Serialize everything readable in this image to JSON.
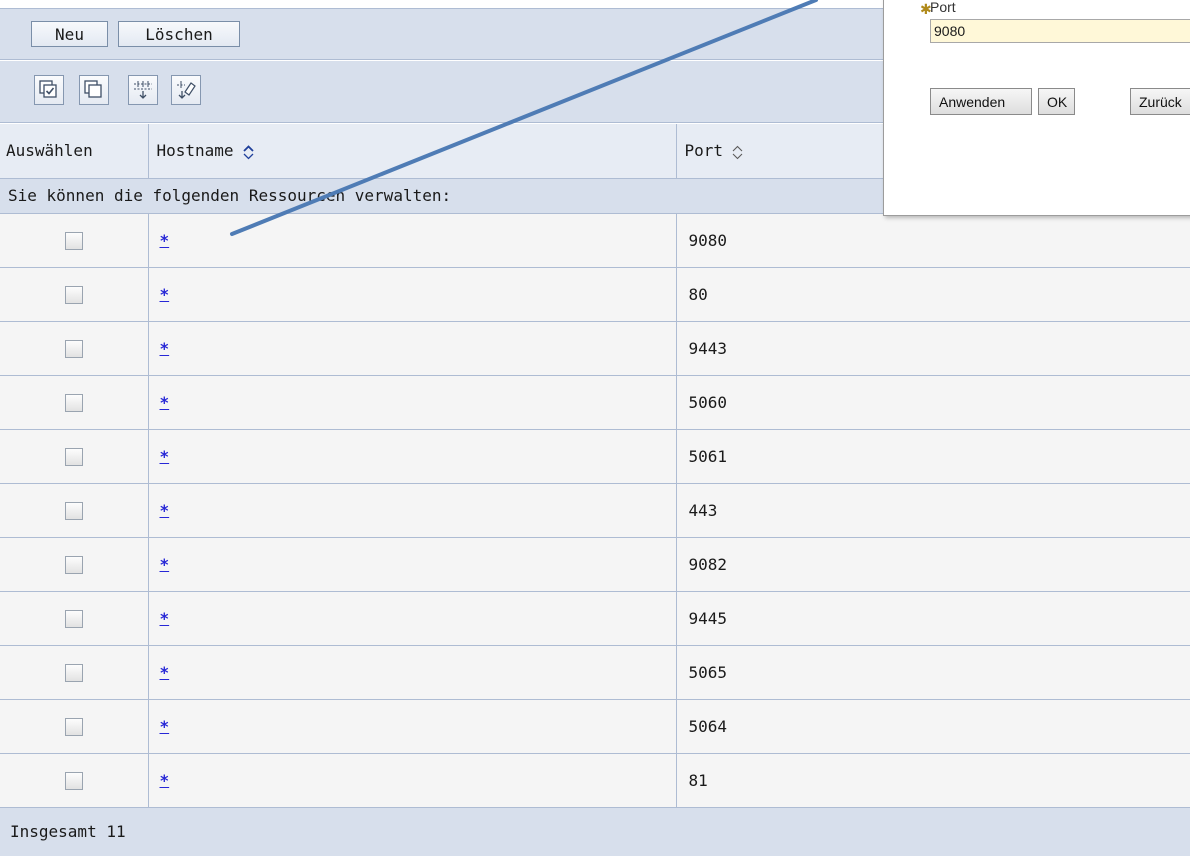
{
  "toolbar": {
    "new_label": "Neu",
    "delete_label": "Löschen"
  },
  "icon_toolbar": {
    "icons": [
      "select-all-icon",
      "deselect-all-icon",
      "show-filter-icon",
      "clear-filter-icon"
    ]
  },
  "table": {
    "columns": [
      "Auswählen",
      "Hostname",
      "Port"
    ],
    "caption": "Sie können die folgenden Ressourcen verwalten:",
    "rows": [
      {
        "hostname": "*",
        "port": "9080"
      },
      {
        "hostname": "*",
        "port": "80"
      },
      {
        "hostname": "*",
        "port": "9443"
      },
      {
        "hostname": "*",
        "port": "5060"
      },
      {
        "hostname": "*",
        "port": "5061"
      },
      {
        "hostname": "*",
        "port": "443"
      },
      {
        "hostname": "*",
        "port": "9082"
      },
      {
        "hostname": "*",
        "port": "9445"
      },
      {
        "hostname": "*",
        "port": "5065"
      },
      {
        "hostname": "*",
        "port": "5064"
      },
      {
        "hostname": "*",
        "port": "81"
      }
    ],
    "footer": "Insgesamt 11"
  },
  "edit_panel": {
    "port_label": "Port",
    "port_value": "9080",
    "buttons": [
      "Anwenden",
      "OK",
      "Zurück"
    ]
  },
  "colors": {
    "header_bg": "#d7dfec",
    "row_bg": "#f5f5f5",
    "border": "#aebcd3",
    "link": "#2727d6",
    "input_bg": "#fff8d8",
    "arrow": "#4f7cb5"
  }
}
